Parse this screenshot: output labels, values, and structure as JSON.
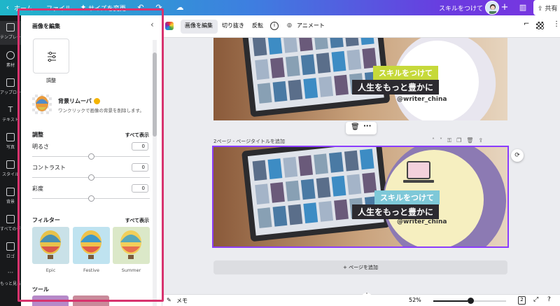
{
  "topbar": {
    "home": "ホーム",
    "file": "ファイル",
    "resize": "サイズを変更",
    "project_title": "スキルをつけて",
    "share": "共有"
  },
  "leftnav": {
    "items": [
      {
        "label": "テンプレート",
        "icon": "template-icon"
      },
      {
        "label": "素材",
        "icon": "elements-icon"
      },
      {
        "label": "アップロード",
        "icon": "upload-icon"
      },
      {
        "label": "テキスト",
        "icon": "text-icon"
      },
      {
        "label": "写真",
        "icon": "photo-icon"
      },
      {
        "label": "スタイル",
        "icon": "style-icon"
      },
      {
        "label": "背景",
        "icon": "background-icon"
      },
      {
        "label": "すべてのデザイン",
        "icon": "all-designs-icon"
      },
      {
        "label": "ロゴ",
        "icon": "logo-icon"
      },
      {
        "label": "もっと見る",
        "icon": "more-icon"
      }
    ]
  },
  "panel": {
    "title": "画像を編集",
    "adjust_tile_label": "調整",
    "bg_remover": {
      "title": "背景リムーバ",
      "desc": "ワンクリックで画像の背景を削除します。"
    },
    "adjust": {
      "section": "調整",
      "see_all": "すべて表示",
      "sliders": [
        {
          "label": "明るさ",
          "value": "0"
        },
        {
          "label": "コントラスト",
          "value": "0"
        },
        {
          "label": "彩度",
          "value": "0"
        }
      ]
    },
    "filters": {
      "section": "フィルター",
      "see_all": "すべて表示",
      "items": [
        "Epic",
        "Festive",
        "Summer"
      ]
    },
    "tools": {
      "section": "ツール"
    }
  },
  "ctxbar": {
    "edit_image": "画像を編集",
    "crop": "切り抜き",
    "flip": "反転",
    "animate": "アニメート"
  },
  "canvas": {
    "banner_line1": "スキルをつけて",
    "banner_line2": "人生をもっと豊かに",
    "handle": "@writer_china",
    "page2_label": "2ページ - ページタイトルを追加",
    "add_page": "+ ページを追加"
  },
  "bottombar": {
    "notes": "メモ",
    "zoom": "52%",
    "zoom_fraction": 0.52,
    "pages": "2"
  },
  "colors": {
    "highlight": "#d8336e",
    "accent_teal": "#7ec8d8",
    "lime": "#c6d93a",
    "purple_ring": "#8c7ab3"
  }
}
